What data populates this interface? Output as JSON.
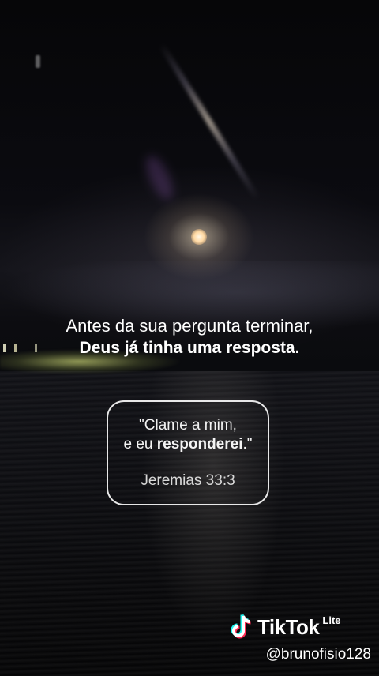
{
  "headline": {
    "line1": "Antes da sua pergunta terminar,",
    "line2": "Deus já tinha uma resposta."
  },
  "verse": {
    "quote_line1": "\"Clame a mim,",
    "quote_line2_start": "e eu ",
    "quote_line2_bold": "responderei",
    "quote_line2_end": ".\"",
    "reference": "Jeremias 33:3"
  },
  "watermark": {
    "brand": "TikTok",
    "edition": "Lite",
    "icon": "tiktok-note-icon",
    "handle": "@brunofisio128"
  },
  "colors": {
    "text": "#ffffff",
    "tiktok_cyan": "#25F4EE",
    "tiktok_red": "#FE2C55"
  }
}
